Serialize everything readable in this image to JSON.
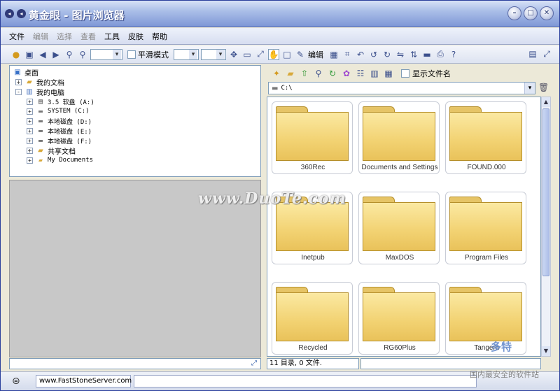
{
  "window": {
    "title": "黄金眼  - 图片浏览器",
    "controls": [
      "minimize",
      "maximize",
      "close"
    ]
  },
  "menubar": {
    "items": [
      {
        "label": "文件",
        "enabled": true
      },
      {
        "label": "编辑",
        "enabled": false
      },
      {
        "label": "选择",
        "enabled": false
      },
      {
        "label": "查看",
        "enabled": false
      },
      {
        "label": "工具",
        "enabled": true
      },
      {
        "label": "皮肤",
        "enabled": true
      },
      {
        "label": "帮助",
        "enabled": true
      }
    ]
  },
  "toolbar": {
    "smooth_label": "平滑模式",
    "edit_label": "编辑",
    "smooth_checked": false
  },
  "tree": {
    "items": [
      {
        "label": "桌面",
        "icon": "desktop-icon",
        "level": 0,
        "expander": ""
      },
      {
        "label": "我的文档",
        "icon": "folder-icon",
        "level": 1,
        "expander": "+"
      },
      {
        "label": "我的电脑",
        "icon": "computer-icon",
        "level": 1,
        "expander": "-"
      },
      {
        "label": "3.5 软盘 (A:)",
        "icon": "floppy-icon",
        "level": 2,
        "expander": "+"
      },
      {
        "label": "SYSTEM (C:)",
        "icon": "drive-icon",
        "level": 2,
        "expander": "+"
      },
      {
        "label": "本地磁盘 (D:)",
        "icon": "drive-icon",
        "level": 2,
        "expander": "+"
      },
      {
        "label": "本地磁盘 (E:)",
        "icon": "drive-icon",
        "level": 2,
        "expander": "+"
      },
      {
        "label": "本地磁盘 (F:)",
        "icon": "drive-icon",
        "level": 2,
        "expander": "+"
      },
      {
        "label": "共享文档",
        "icon": "folder-icon",
        "level": 2,
        "expander": "+"
      },
      {
        "label": "My Documents",
        "icon": "folder-icon",
        "level": 2,
        "expander": "+"
      }
    ]
  },
  "right_toolbar": {
    "show_filename_label": "显示文件名",
    "show_filename_checked": false
  },
  "path": {
    "value": "C:\\"
  },
  "folders": [
    "360Rec",
    "Documents and Settings",
    "FOUND.000",
    "Inetpub",
    "MaxDOS",
    "Program Files",
    "Recycled",
    "RG60Plus",
    "Tangent"
  ],
  "status": {
    "summary": "11 目录, 0 文件."
  },
  "bottom": {
    "url": "www.FastStoneServer.com"
  },
  "watermarks": {
    "center": "www.DuoTe.com",
    "corner_brand": "多特",
    "corner_text": "国内最安全的软件站"
  },
  "colors": {
    "title_gradient_top": "#d8e2f6",
    "title_gradient_bottom": "#7e97d6",
    "folder_fill": "#f2d272",
    "preview_bg": "#c8c8c8"
  }
}
